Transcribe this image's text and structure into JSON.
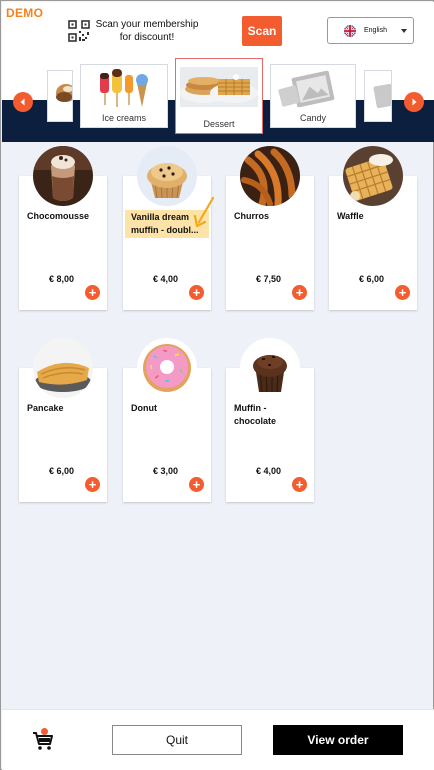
{
  "header": {
    "demo_label": "DEMO",
    "membership_text": "Scan your membership for discount!",
    "scan_label": "Scan",
    "language": "English"
  },
  "categories": [
    {
      "label": "Ice creams",
      "icon": "ice-cream-image"
    },
    {
      "label": "Dessert",
      "icon": "dessert-image",
      "active": true
    },
    {
      "label": "Candy",
      "icon": "image-placeholder-icon"
    }
  ],
  "products": [
    {
      "name": "Chocomousse",
      "price": "€ 8,00",
      "image": "chocolate-mousse-image"
    },
    {
      "name": "Vanilla dream muffin - doubl...",
      "price": "€ 4,00",
      "image": "vanilla-muffin-image",
      "highlighted": true
    },
    {
      "name": "Churros",
      "price": "€ 7,50",
      "image": "churros-image"
    },
    {
      "name": "Waffle",
      "price": "€ 6,00",
      "image": "waffle-image"
    },
    {
      "name": "Pancake",
      "price": "€ 6,00",
      "image": "pancake-image"
    },
    {
      "name": "Donut",
      "price": "€ 3,00",
      "image": "donut-image"
    },
    {
      "name": "Muffin - chocolate",
      "price": "€ 4,00",
      "image": "chocolate-muffin-image"
    }
  ],
  "footer": {
    "quit_label": "Quit",
    "view_order_label": "View order"
  },
  "colors": {
    "accent": "#f25c2f",
    "navy_band": "#0c1f3f",
    "demo": "#f4821f",
    "highlight": "#fde3a7"
  }
}
